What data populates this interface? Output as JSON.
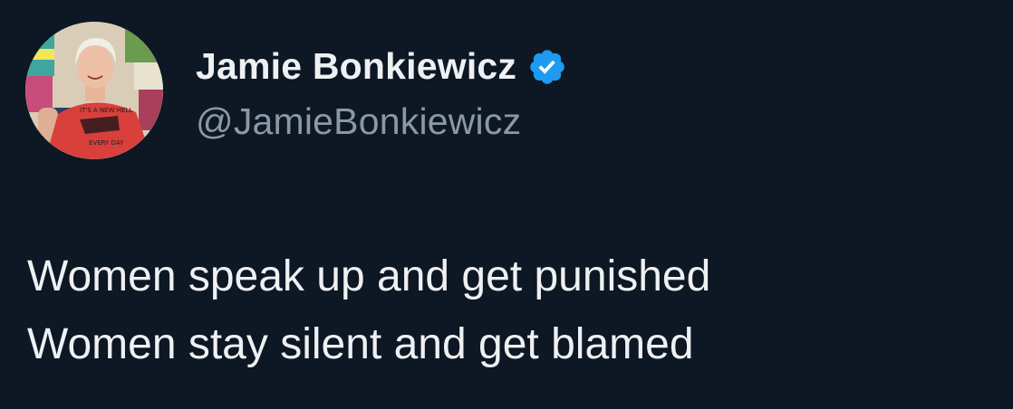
{
  "author": {
    "display_name": "Jamie Bonkiewicz",
    "handle": "@JamieBonkiewicz",
    "verified": true,
    "avatar_shirt_text_top": "IT'S A NEW HELL",
    "avatar_shirt_text_bottom": "EVERY DAY"
  },
  "tweet": {
    "lines": [
      "Women speak up and get punished",
      "Women stay silent and get blamed"
    ]
  },
  "colors": {
    "background": "#0e1724",
    "text": "#eef0f2",
    "handle": "#8b98a5",
    "verified_badge": "#1d9bf0"
  },
  "icons": {
    "verified": "verified-badge-icon"
  }
}
